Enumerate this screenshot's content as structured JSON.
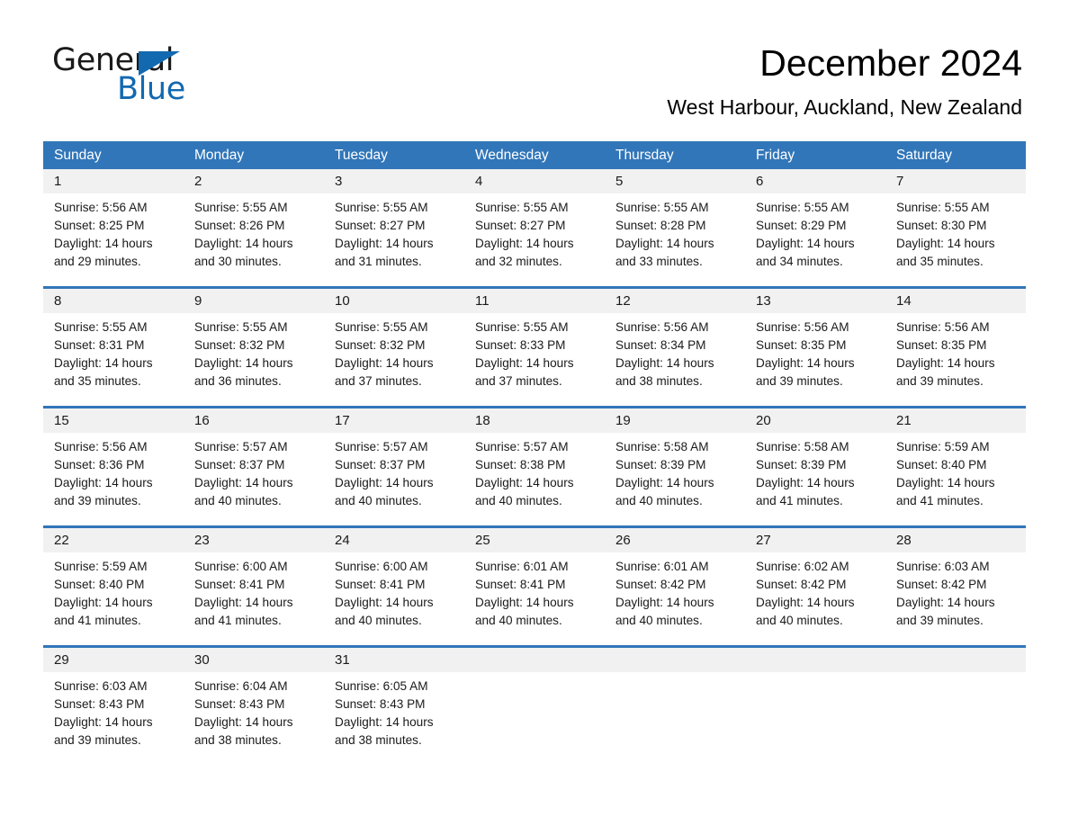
{
  "brand": {
    "name_part1": "General",
    "name_part2": "Blue",
    "triangle_icon": "triangle-icon",
    "accent_color": "#1269b0"
  },
  "header": {
    "title": "December 2024",
    "subtitle": "West Harbour, Auckland, New Zealand"
  },
  "colors": {
    "header_blue": "#3176b9",
    "daynum_band": "#f1f1f1",
    "text": "#1a1a1a"
  },
  "weekdays": [
    "Sunday",
    "Monday",
    "Tuesday",
    "Wednesday",
    "Thursday",
    "Friday",
    "Saturday"
  ],
  "weeks": [
    {
      "days": [
        {
          "num": "1",
          "sunrise": "Sunrise: 5:56 AM",
          "sunset": "Sunset: 8:25 PM",
          "daylight1": "Daylight: 14 hours",
          "daylight2": "and 29 minutes."
        },
        {
          "num": "2",
          "sunrise": "Sunrise: 5:55 AM",
          "sunset": "Sunset: 8:26 PM",
          "daylight1": "Daylight: 14 hours",
          "daylight2": "and 30 minutes."
        },
        {
          "num": "3",
          "sunrise": "Sunrise: 5:55 AM",
          "sunset": "Sunset: 8:27 PM",
          "daylight1": "Daylight: 14 hours",
          "daylight2": "and 31 minutes."
        },
        {
          "num": "4",
          "sunrise": "Sunrise: 5:55 AM",
          "sunset": "Sunset: 8:27 PM",
          "daylight1": "Daylight: 14 hours",
          "daylight2": "and 32 minutes."
        },
        {
          "num": "5",
          "sunrise": "Sunrise: 5:55 AM",
          "sunset": "Sunset: 8:28 PM",
          "daylight1": "Daylight: 14 hours",
          "daylight2": "and 33 minutes."
        },
        {
          "num": "6",
          "sunrise": "Sunrise: 5:55 AM",
          "sunset": "Sunset: 8:29 PM",
          "daylight1": "Daylight: 14 hours",
          "daylight2": "and 34 minutes."
        },
        {
          "num": "7",
          "sunrise": "Sunrise: 5:55 AM",
          "sunset": "Sunset: 8:30 PM",
          "daylight1": "Daylight: 14 hours",
          "daylight2": "and 35 minutes."
        }
      ]
    },
    {
      "days": [
        {
          "num": "8",
          "sunrise": "Sunrise: 5:55 AM",
          "sunset": "Sunset: 8:31 PM",
          "daylight1": "Daylight: 14 hours",
          "daylight2": "and 35 minutes."
        },
        {
          "num": "9",
          "sunrise": "Sunrise: 5:55 AM",
          "sunset": "Sunset: 8:32 PM",
          "daylight1": "Daylight: 14 hours",
          "daylight2": "and 36 minutes."
        },
        {
          "num": "10",
          "sunrise": "Sunrise: 5:55 AM",
          "sunset": "Sunset: 8:32 PM",
          "daylight1": "Daylight: 14 hours",
          "daylight2": "and 37 minutes."
        },
        {
          "num": "11",
          "sunrise": "Sunrise: 5:55 AM",
          "sunset": "Sunset: 8:33 PM",
          "daylight1": "Daylight: 14 hours",
          "daylight2": "and 37 minutes."
        },
        {
          "num": "12",
          "sunrise": "Sunrise: 5:56 AM",
          "sunset": "Sunset: 8:34 PM",
          "daylight1": "Daylight: 14 hours",
          "daylight2": "and 38 minutes."
        },
        {
          "num": "13",
          "sunrise": "Sunrise: 5:56 AM",
          "sunset": "Sunset: 8:35 PM",
          "daylight1": "Daylight: 14 hours",
          "daylight2": "and 39 minutes."
        },
        {
          "num": "14",
          "sunrise": "Sunrise: 5:56 AM",
          "sunset": "Sunset: 8:35 PM",
          "daylight1": "Daylight: 14 hours",
          "daylight2": "and 39 minutes."
        }
      ]
    },
    {
      "days": [
        {
          "num": "15",
          "sunrise": "Sunrise: 5:56 AM",
          "sunset": "Sunset: 8:36 PM",
          "daylight1": "Daylight: 14 hours",
          "daylight2": "and 39 minutes."
        },
        {
          "num": "16",
          "sunrise": "Sunrise: 5:57 AM",
          "sunset": "Sunset: 8:37 PM",
          "daylight1": "Daylight: 14 hours",
          "daylight2": "and 40 minutes."
        },
        {
          "num": "17",
          "sunrise": "Sunrise: 5:57 AM",
          "sunset": "Sunset: 8:37 PM",
          "daylight1": "Daylight: 14 hours",
          "daylight2": "and 40 minutes."
        },
        {
          "num": "18",
          "sunrise": "Sunrise: 5:57 AM",
          "sunset": "Sunset: 8:38 PM",
          "daylight1": "Daylight: 14 hours",
          "daylight2": "and 40 minutes."
        },
        {
          "num": "19",
          "sunrise": "Sunrise: 5:58 AM",
          "sunset": "Sunset: 8:39 PM",
          "daylight1": "Daylight: 14 hours",
          "daylight2": "and 40 minutes."
        },
        {
          "num": "20",
          "sunrise": "Sunrise: 5:58 AM",
          "sunset": "Sunset: 8:39 PM",
          "daylight1": "Daylight: 14 hours",
          "daylight2": "and 41 minutes."
        },
        {
          "num": "21",
          "sunrise": "Sunrise: 5:59 AM",
          "sunset": "Sunset: 8:40 PM",
          "daylight1": "Daylight: 14 hours",
          "daylight2": "and 41 minutes."
        }
      ]
    },
    {
      "days": [
        {
          "num": "22",
          "sunrise": "Sunrise: 5:59 AM",
          "sunset": "Sunset: 8:40 PM",
          "daylight1": "Daylight: 14 hours",
          "daylight2": "and 41 minutes."
        },
        {
          "num": "23",
          "sunrise": "Sunrise: 6:00 AM",
          "sunset": "Sunset: 8:41 PM",
          "daylight1": "Daylight: 14 hours",
          "daylight2": "and 41 minutes."
        },
        {
          "num": "24",
          "sunrise": "Sunrise: 6:00 AM",
          "sunset": "Sunset: 8:41 PM",
          "daylight1": "Daylight: 14 hours",
          "daylight2": "and 40 minutes."
        },
        {
          "num": "25",
          "sunrise": "Sunrise: 6:01 AM",
          "sunset": "Sunset: 8:41 PM",
          "daylight1": "Daylight: 14 hours",
          "daylight2": "and 40 minutes."
        },
        {
          "num": "26",
          "sunrise": "Sunrise: 6:01 AM",
          "sunset": "Sunset: 8:42 PM",
          "daylight1": "Daylight: 14 hours",
          "daylight2": "and 40 minutes."
        },
        {
          "num": "27",
          "sunrise": "Sunrise: 6:02 AM",
          "sunset": "Sunset: 8:42 PM",
          "daylight1": "Daylight: 14 hours",
          "daylight2": "and 40 minutes."
        },
        {
          "num": "28",
          "sunrise": "Sunrise: 6:03 AM",
          "sunset": "Sunset: 8:42 PM",
          "daylight1": "Daylight: 14 hours",
          "daylight2": "and 39 minutes."
        }
      ]
    },
    {
      "days": [
        {
          "num": "29",
          "sunrise": "Sunrise: 6:03 AM",
          "sunset": "Sunset: 8:43 PM",
          "daylight1": "Daylight: 14 hours",
          "daylight2": "and 39 minutes."
        },
        {
          "num": "30",
          "sunrise": "Sunrise: 6:04 AM",
          "sunset": "Sunset: 8:43 PM",
          "daylight1": "Daylight: 14 hours",
          "daylight2": "and 38 minutes."
        },
        {
          "num": "31",
          "sunrise": "Sunrise: 6:05 AM",
          "sunset": "Sunset: 8:43 PM",
          "daylight1": "Daylight: 14 hours",
          "daylight2": "and 38 minutes."
        },
        {
          "num": "",
          "sunrise": "",
          "sunset": "",
          "daylight1": "",
          "daylight2": ""
        },
        {
          "num": "",
          "sunrise": "",
          "sunset": "",
          "daylight1": "",
          "daylight2": ""
        },
        {
          "num": "",
          "sunrise": "",
          "sunset": "",
          "daylight1": "",
          "daylight2": ""
        },
        {
          "num": "",
          "sunrise": "",
          "sunset": "",
          "daylight1": "",
          "daylight2": ""
        }
      ]
    }
  ]
}
